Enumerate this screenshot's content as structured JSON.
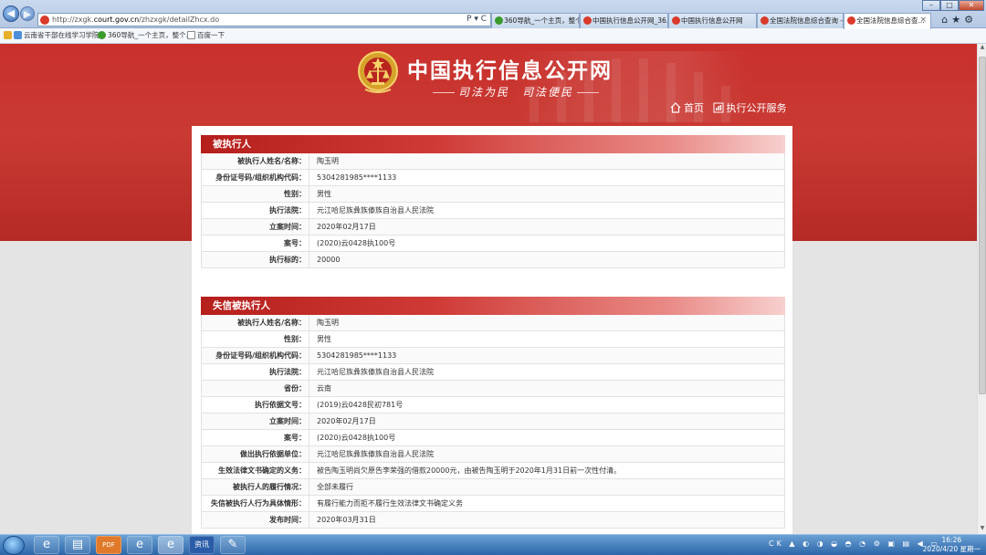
{
  "browser": {
    "url_prefix": "http://zxgk.",
    "url_domain": "court.gov.cn",
    "url_suffix": "/zhzxgk/detailZhcx.do",
    "addr_tools": "P ▾ C",
    "tabs": [
      {
        "label": "360导航_一个主页，整个..."
      },
      {
        "label": "中国执行信息公开网_36..."
      },
      {
        "label": "中国执行信息公开网"
      },
      {
        "label": "全国法院信息综合查询 -..."
      },
      {
        "label": "全国法院信息综合查..."
      }
    ],
    "tab_close": "×",
    "right_icons": "⌂★⚙",
    "favorites": [
      {
        "label": "云南省干部在线学习学院"
      },
      {
        "label": "360导航_一个主页，整个..."
      },
      {
        "label": "百度一下"
      }
    ]
  },
  "site": {
    "title": "中国执行信息公开网",
    "slogan": "司法为民　司法便民",
    "nav": [
      {
        "label": "首页"
      },
      {
        "label": "执行公开服务"
      }
    ]
  },
  "executed": {
    "heading": "被执行人",
    "rows": [
      {
        "label": "被执行人姓名/名称：",
        "value": "陶玉明"
      },
      {
        "label": "身份证号码/组织机构代码：",
        "value": "5304281985****1133"
      },
      {
        "label": "性别：",
        "value": "男性"
      },
      {
        "label": "执行法院：",
        "value": "元江哈尼族彝族傣族自治县人民法院"
      },
      {
        "label": "立案时间：",
        "value": "2020年02月17日"
      },
      {
        "label": "案号：",
        "value": "(2020)云0428执100号"
      },
      {
        "label": "执行标的：",
        "value": "20000"
      }
    ]
  },
  "dishonest": {
    "heading": "失信被执行人",
    "rows": [
      {
        "label": "被执行人姓名/名称：",
        "value": "陶玉明"
      },
      {
        "label": "性别：",
        "value": "男性"
      },
      {
        "label": "身份证号码/组织机构代码：",
        "value": "5304281985****1133"
      },
      {
        "label": "执行法院：",
        "value": "元江哈尼族彝族傣族自治县人民法院"
      },
      {
        "label": "省份：",
        "value": "云南"
      },
      {
        "label": "执行依据文号：",
        "value": "(2019)云0428民初781号"
      },
      {
        "label": "立案时间：",
        "value": "2020年02月17日"
      },
      {
        "label": "案号：",
        "value": "(2020)云0428执100号"
      },
      {
        "label": "做出执行依据单位：",
        "value": "元江哈尼族彝族傣族自治县人民法院"
      },
      {
        "label": "生效法律文书确定的义务：",
        "value": "被告陶玉明尚欠原告李荣强的借款20000元，由被告陶玉明于2020年1月31日前一次性付清。"
      },
      {
        "label": "被执行人的履行情况：",
        "value": "全部未履行"
      },
      {
        "label": "失信被执行人行为具体情形：",
        "value": "有履行能力而拒不履行生效法律文书确定义务"
      },
      {
        "label": "发布时间：",
        "value": "2020年03月31日"
      }
    ]
  },
  "taskbar": {
    "apps": [
      {
        "label": "e"
      },
      {
        "label": "▤"
      },
      {
        "label": "PDF"
      },
      {
        "label": "e"
      },
      {
        "label": "e"
      },
      {
        "label": "资讯"
      },
      {
        "label": "✎"
      }
    ],
    "sys_tray": "CK ▲ ◐ ◑ ◒ ◓ ◔ ⚙ ▣ ▤ ◀ ▭",
    "time": "16:26",
    "date": "2020/4/20 星期一"
  },
  "colors": {
    "banner": "#c9302c",
    "section_header": "#cf3a36"
  }
}
